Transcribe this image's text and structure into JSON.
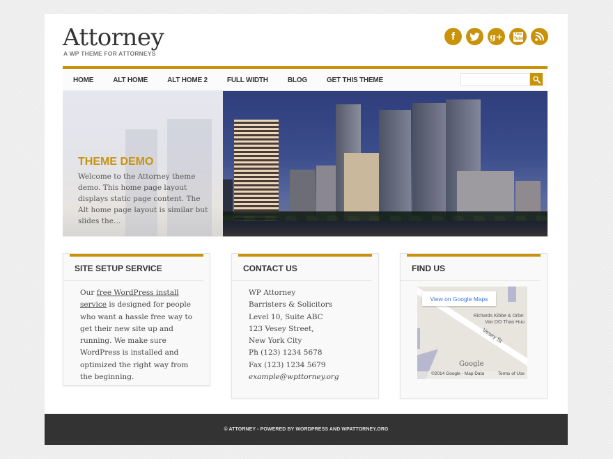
{
  "header": {
    "site_title": "Attorney",
    "tagline": "A WP THEME FOR ATTORNEYS",
    "social": [
      {
        "name": "facebook-icon",
        "glyph": "f"
      },
      {
        "name": "twitter-icon",
        "glyph": ""
      },
      {
        "name": "google-plus-icon",
        "glyph": "g+"
      },
      {
        "name": "youtube-icon",
        "glyph": "You Tube"
      },
      {
        "name": "rss-icon",
        "glyph": ""
      }
    ],
    "accent_color": "#c8930b"
  },
  "nav": {
    "items": [
      "HOME",
      "ALT HOME",
      "ALT HOME 2",
      "FULL WIDTH",
      "BLOG",
      "GET THIS THEME"
    ],
    "search": {
      "value": "",
      "placeholder": "",
      "icon": "search-icon"
    }
  },
  "hero": {
    "title": "THEME DEMO",
    "text": "Welcome to the Attorney theme demo. This home page layout displays static page content. The Alt home page layout is similar but slides the…"
  },
  "widgets": {
    "site_setup": {
      "title": "SITE SETUP SERVICE",
      "text_before": "Our ",
      "link": "free WordPress install service",
      "text_after": " is designed for people who want a hassle free way to get their new site up and running. We make sure WordPress is installed and optimized the right way from the beginning."
    },
    "contact": {
      "title": "CONTACT US",
      "lines": [
        "WP Attorney",
        "Barristers & Solicitors",
        "Level 10, Suite ABC",
        "123 Vesey Street,",
        "New York City",
        "Ph (123) 1234 5678",
        "Fax (123) 1234 5679"
      ],
      "email": "example@wpttorney.org"
    },
    "find_us": {
      "title": "FIND US",
      "map": {
        "view_button": "View on Google Maps",
        "poi": [
          "Richards Kibbe & Orbe:",
          "Van DO Thao Huu"
        ],
        "street": "Vesey St",
        "logo": "Google",
        "copyright": "©2014 Google - Map Data",
        "terms": "Terms of Use"
      }
    }
  },
  "footer": {
    "text": "© ATTORNEY - POWERED BY WORDPRESS AND WPATTORNEY.ORG"
  }
}
